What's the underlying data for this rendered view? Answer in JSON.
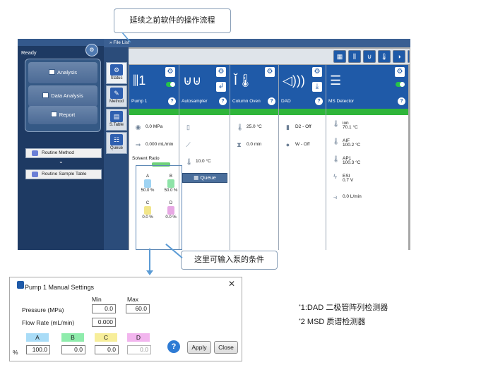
{
  "callouts": {
    "top": "延续之前软件的操作流程",
    "middle": "这里可输入泵的条件"
  },
  "app": {
    "status": "Ready",
    "file_list": "File List",
    "nav": {
      "analysis": "Analysis",
      "data_analysis": "Data Analysis",
      "report": "Report"
    },
    "routine_method": "Routine Method",
    "routine_sample_table": "Routine Sample Table",
    "tabs": [
      "Status",
      "Method",
      "S.Table",
      "Queue"
    ],
    "modules": {
      "pump": {
        "title": "Pump 1",
        "pressure": "0.0  MPa",
        "flow": "0.000  mL/min",
        "solvent_ratio": "Solvent Ratio",
        "bottles": [
          {
            "name": "A",
            "pct": "50.0  %"
          },
          {
            "name": "B",
            "pct": "50.0  %"
          },
          {
            "name": "C",
            "pct": "0.0  %"
          },
          {
            "name": "D",
            "pct": "0.0  %"
          }
        ]
      },
      "autosampler": {
        "title": "Autosampler",
        "temp": "10.0  °C",
        "queue": "Queue"
      },
      "column_oven": {
        "title": "Column Oven",
        "temp": "25.0  °C",
        "time": "0.0  min"
      },
      "dad": {
        "title": "DAD",
        "d2": "D2  -  Off",
        "w": "W  -  Off"
      },
      "ms": {
        "title": "MS Detector",
        "ion_label": "ion",
        "ion": "70.1  °C",
        "aif_label": "AIF",
        "aif": "100.2  °C",
        "ap1_label": "AP1",
        "ap1": "100.3  °C",
        "esi_label": "ESI",
        "esi": "0.7  V",
        "flow": "0.0  L/min"
      }
    }
  },
  "dialog": {
    "title": "Pump 1 Manual Settings",
    "close": "✕",
    "min_header": "Min",
    "max_header": "Max",
    "pressure_label": "Pressure (MPa)",
    "pressure_min": "0.0",
    "pressure_max": "60.0",
    "flow_label": "Flow Rate (mL/min)",
    "flow_value": "0.000",
    "percent_label": "%",
    "channels": [
      {
        "name": "A",
        "value": "100.0",
        "color": "#a9dcf7"
      },
      {
        "name": "B",
        "value": "0.0",
        "color": "#8fecac"
      },
      {
        "name": "C",
        "value": "0.0",
        "color": "#f7ee9a"
      },
      {
        "name": "D",
        "value": "0.0",
        "color": "#f2b5ee"
      }
    ],
    "apply": "Apply",
    "close_btn": "Close",
    "help": "?"
  },
  "notes": {
    "n1_mark": "*",
    "n1": "1:DAD 二极管阵列检测器",
    "n2_mark": "*",
    "n2": "2 MSD 质谱检测器"
  }
}
